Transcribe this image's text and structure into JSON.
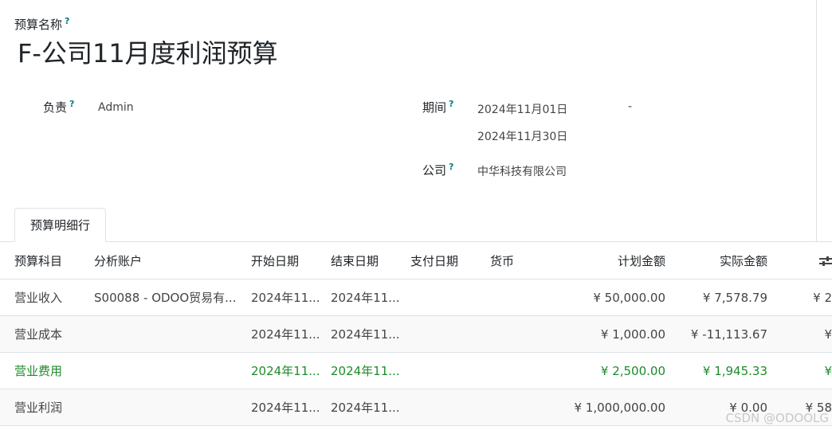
{
  "form": {
    "name_label": "预算名称",
    "name_value": "F-公司11月度利润预算",
    "help_mark": "?",
    "responsible_label": "负责",
    "responsible_value": "Admin",
    "period_label": "期间",
    "period_start": "2024年11月01日",
    "period_sep": "-",
    "period_end": "2024年11月30日",
    "company_label": "公司",
    "company_value": "中华科技有限公司"
  },
  "tabs": [
    {
      "label": "预算明细行"
    }
  ],
  "table": {
    "columns": [
      "预算科目",
      "分析账户",
      "开始日期",
      "结束日期",
      "支付日期",
      "货币",
      "计划金额",
      "实际金额",
      ""
    ],
    "rows": [
      {
        "subject": "营业收入",
        "account": "S00088 - ODOO贸易有...",
        "start": "2024年11...",
        "end": "2024年11...",
        "pay": "",
        "currency": "",
        "planned": "¥ 50,000.00",
        "actual": "¥ 7,578.79",
        "extra": "¥ 2"
      },
      {
        "subject": "营业成本",
        "account": "",
        "start": "2024年11...",
        "end": "2024年11...",
        "pay": "",
        "currency": "",
        "planned": "¥ 1,000.00",
        "actual": "¥ -11,113.67",
        "extra": "¥"
      },
      {
        "subject": "营业费用",
        "account": "",
        "start": "2024年11...",
        "end": "2024年11...",
        "pay": "",
        "currency": "",
        "planned": "¥ 2,500.00",
        "actual": "¥ 1,945.33",
        "extra": "¥"
      },
      {
        "subject": "营业利润",
        "account": "",
        "start": "2024年11...",
        "end": "2024年11...",
        "pay": "",
        "currency": "",
        "planned": "¥ 1,000,000.00",
        "actual": "¥ 0.00",
        "extra": "¥ 58"
      }
    ]
  },
  "watermark": "CSDN @ODOOLG",
  "colors": {
    "help": "#017e84",
    "highlight_row": "#1c8b2b"
  }
}
